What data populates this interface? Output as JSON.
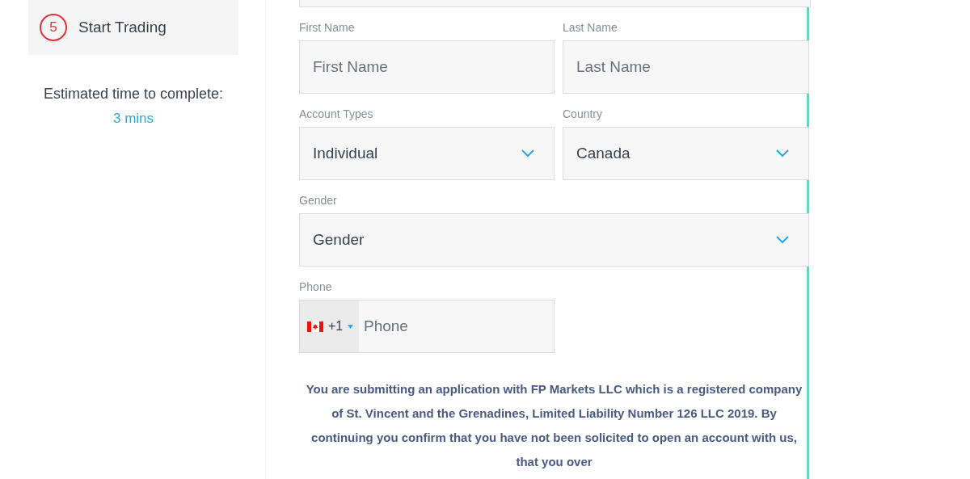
{
  "step": {
    "number": "5",
    "label": "Start Trading"
  },
  "estimate": {
    "label": "Estimated time to complete:",
    "value": "3 mins"
  },
  "fields": [
    {
      "kind": "text",
      "label": "First Name",
      "placeholder": "First Name"
    },
    {
      "kind": "text",
      "label": "Last Name",
      "placeholder": "Last Name"
    },
    {
      "kind": "select",
      "label": "Account Types",
      "value": "Individual"
    },
    {
      "kind": "select",
      "label": "Country",
      "value": "Canada"
    },
    {
      "kind": "select",
      "label": "Gender",
      "value": "Gender"
    },
    {
      "kind": "phone",
      "label": "Phone",
      "code": "+1",
      "placeholder": "Phone"
    }
  ],
  "notice": "You are submitting an application with FP Markets LLC which is a registered company of St. Vincent and the Grenadines, Limited Liability Number 126 LLC 2019. By continuing you confirm that you have not been solicited to open an account with us, that you over"
}
